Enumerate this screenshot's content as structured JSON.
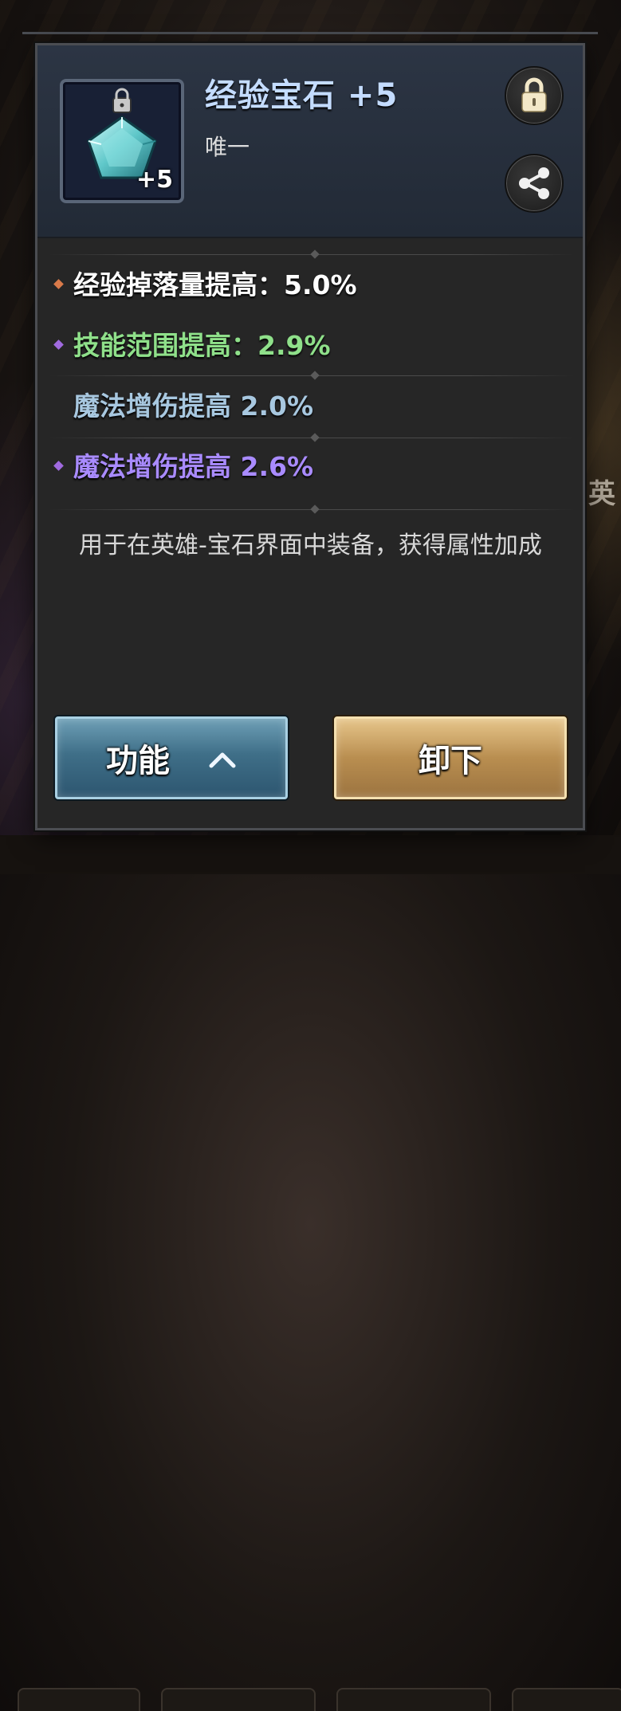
{
  "item": {
    "name": "经验宝石 +5",
    "rarity": "唯一",
    "level_badge": "+5",
    "icon": "pentagon-gem-icon",
    "locked_icon": "padlock-icon"
  },
  "actions": {
    "lock_icon": "padlock-icon",
    "share_icon": "share-icon"
  },
  "stats": [
    {
      "text": "经验掉落量提高：5.0%",
      "color": "#ffffff",
      "marker": "#d97a4a"
    },
    {
      "text": "技能范围提高：2.9%",
      "color": "#8fe08a",
      "marker": "#a06adf"
    },
    {
      "text": "魔法增伤提高 2.0%",
      "color": "#a8c8e0",
      "marker": null
    },
    {
      "text": "魔法增伤提高 2.6%",
      "color": "#a98bff",
      "marker": "#a06adf"
    }
  ],
  "description": "用于在英雄-宝石界面中装备，获得属性加成",
  "buttons": {
    "function_label": "功能",
    "unequip_label": "卸下"
  },
  "background": {
    "side_text": "英"
  },
  "colors": {
    "title": "#c4dcff",
    "function_button": "#3f6f88",
    "unequip_button": "#b98e50"
  }
}
